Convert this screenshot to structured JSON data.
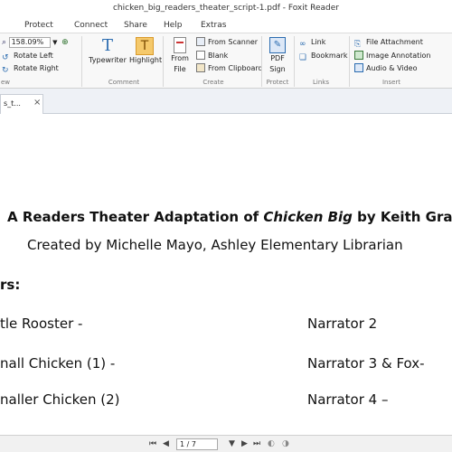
{
  "window": {
    "title": "chicken_big_readers_theater_script-1.pdf - Foxit Reader"
  },
  "menu": [
    "Protect",
    "Connect",
    "Share",
    "Help",
    "Extras"
  ],
  "ribbon": {
    "zoom_value": "158.09%",
    "rotate_left": "Rotate Left",
    "rotate_right": "Rotate Right",
    "view_group_fragment": "ew",
    "typewriter": "Typewriter",
    "highlight": "Highlight",
    "comment_group": "Comment",
    "from_file_line1": "From",
    "from_file_line2": "File",
    "from_scanner": "From Scanner",
    "blank": "Blank",
    "from_clipboard": "From Clipboard",
    "create_group": "Create",
    "pdf_sign_line1": "PDF",
    "pdf_sign_line2": "Sign",
    "protect_group": "Protect",
    "link": "Link",
    "bookmark": "Bookmark",
    "links_group": "Links",
    "file_attachment": "File Attachment",
    "image_annotation": "Image Annotation",
    "audio_video": "Audio & Video",
    "insert_group": "Insert"
  },
  "doc_tab": {
    "label": "s_t...",
    "close": "×"
  },
  "document": {
    "title_pre": "A Readers Theater Adaptation of ",
    "title_italic": "Chicken Big",
    "title_post": " by Keith Grave",
    "credit": "Created by Michelle Mayo, Ashley Elementary Librarian",
    "characters_heading": "rs:",
    "rows": [
      {
        "left": "tle Rooster -",
        "right": "Narrator 2"
      },
      {
        "left": "nall Chicken (1) -",
        "right": "Narrator 3 & Fox-"
      },
      {
        "left": "naller Chicken (2)",
        "right": "Narrator 4 –"
      }
    ]
  },
  "status": {
    "page_display": "1 / 7"
  }
}
